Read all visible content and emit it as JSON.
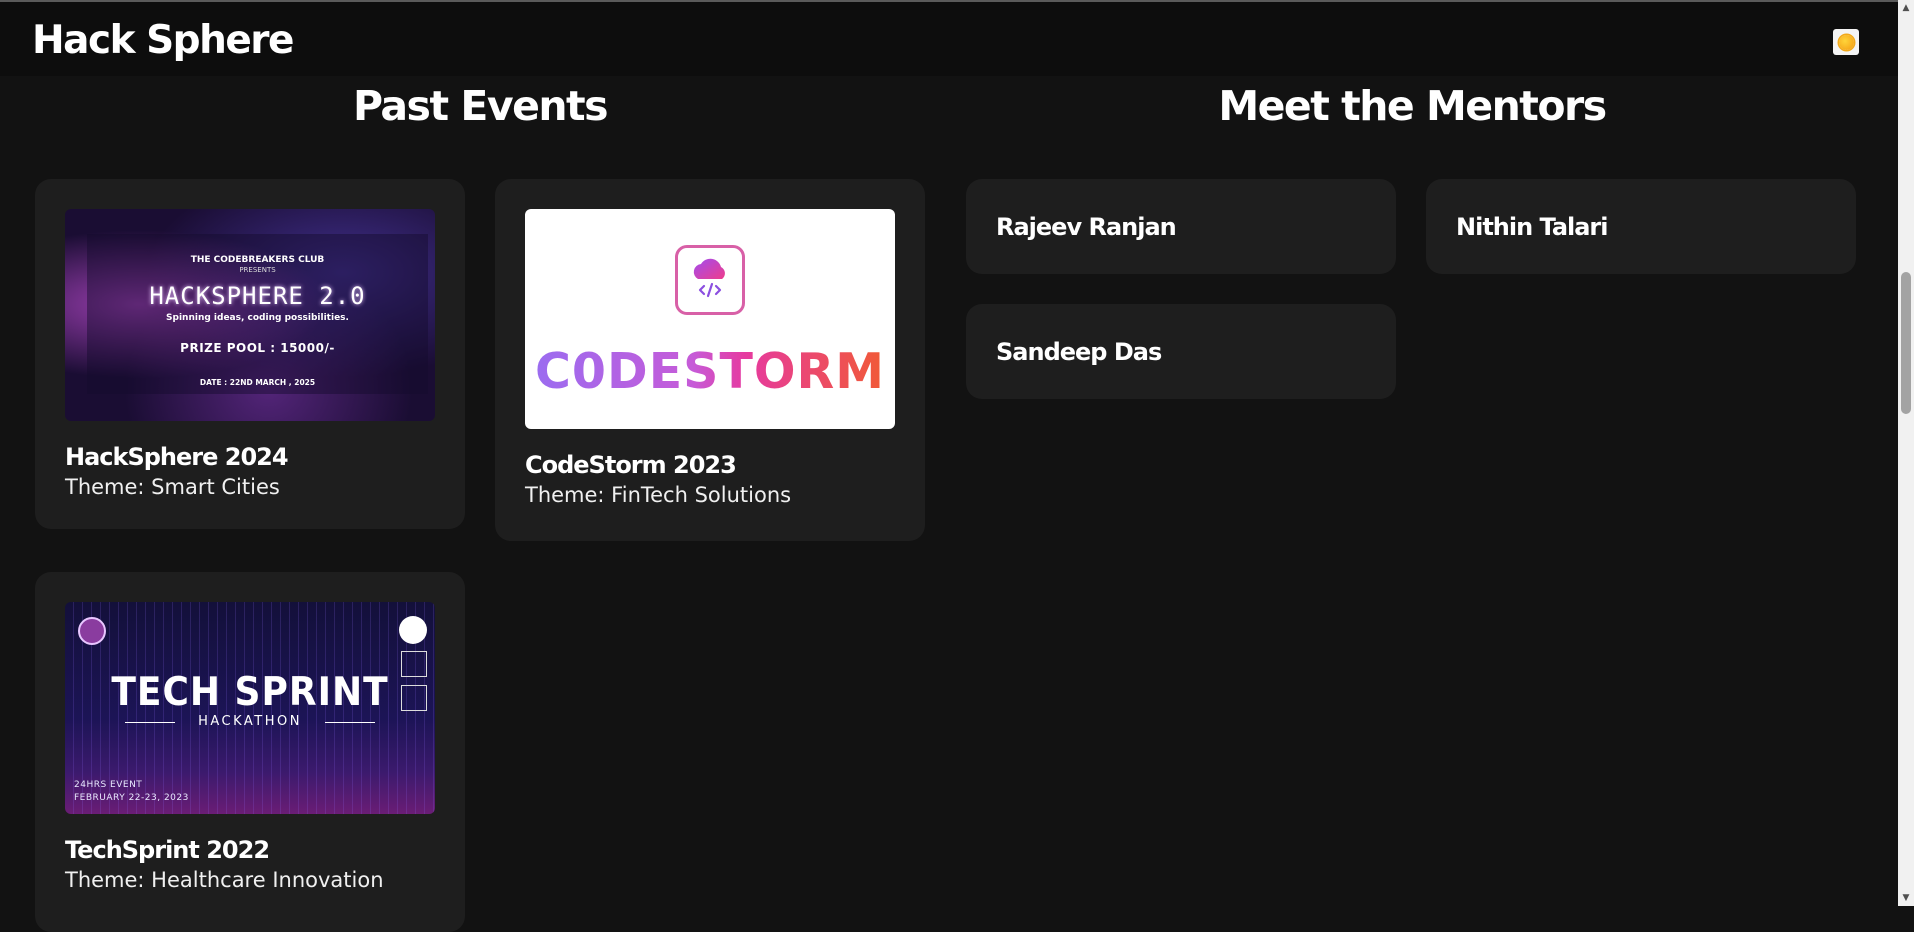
{
  "header": {
    "brand": "Hack Sphere"
  },
  "sections": {
    "events_title": "Past Events",
    "mentors_title": "Meet the Mentors"
  },
  "events": [
    {
      "title": "HackSphere 2024",
      "theme": "Theme: Smart Cities",
      "poster": {
        "club": "THE CODEBREAKERS CLUB",
        "presents": "PRESENTS",
        "headline": "HACKSPHERE 2.0",
        "tagline": "Spinning ideas, coding possibilities.",
        "prize": "PRIZE POOL : 15000/-",
        "date": "DATE : 22ND MARCH , 2025"
      }
    },
    {
      "title": "CodeStorm 2023",
      "theme": "Theme: FinTech Solutions",
      "poster": {
        "wordmark": "C0DESTORM"
      }
    },
    {
      "title": "TechSprint 2022",
      "theme": "Theme: Healthcare Innovation",
      "poster": {
        "headline": "TECH SPRINT",
        "subhead": "HACKATHON",
        "event": "24HRS EVENT",
        "date": "FEBRUARY 22-23, 2023"
      }
    }
  ],
  "mentors": [
    {
      "name": "Rajeev Ranjan"
    },
    {
      "name": "Nithin Talari"
    },
    {
      "name": "Sandeep Das"
    }
  ],
  "icons": {
    "theme_toggle": "sun-icon",
    "cloud": "cloud-code-icon"
  },
  "colors": {
    "background": "#121212",
    "card": "#1e1e1e",
    "navbar": "#0d0d0d"
  }
}
